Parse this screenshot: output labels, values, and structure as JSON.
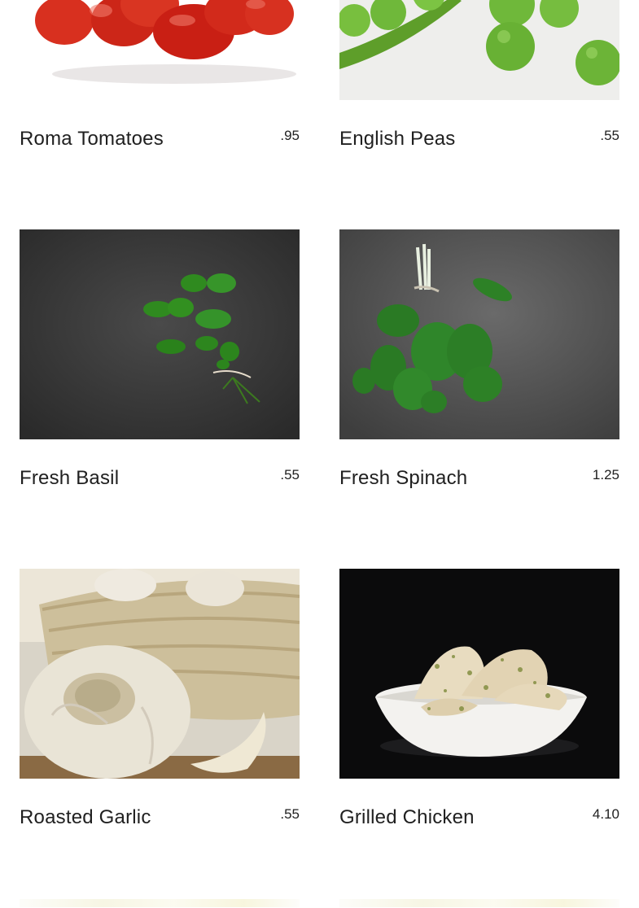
{
  "menu": {
    "items": [
      {
        "name": "Roma Tomatoes",
        "price": ".95",
        "image_icon": "tomatoes-photo"
      },
      {
        "name": "English Peas",
        "price": ".55",
        "image_icon": "peas-photo"
      },
      {
        "name": "Fresh Basil",
        "price": ".55",
        "image_icon": "basil-photo"
      },
      {
        "name": "Fresh Spinach",
        "price": "1.25",
        "image_icon": "spinach-photo"
      },
      {
        "name": "Roasted Garlic",
        "price": ".55",
        "image_icon": "garlic-photo"
      },
      {
        "name": "Grilled Chicken",
        "price": "4.10",
        "image_icon": "chicken-photo"
      }
    ]
  },
  "colors": {
    "text": "#202020",
    "background": "#ffffff",
    "slate": "#3d3d3d",
    "basil": "#2f8a1f",
    "spinach": "#2a7a24",
    "tomato": "#d42a1a",
    "pea": "#6fb83a"
  }
}
